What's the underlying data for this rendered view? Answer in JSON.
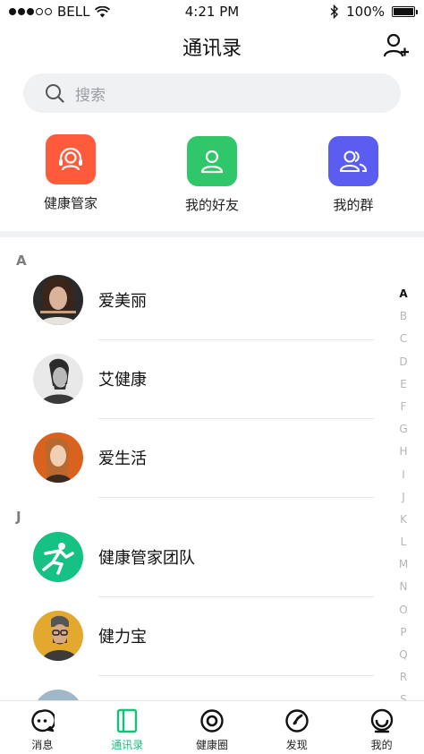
{
  "status_bar": {
    "carrier": "BELL",
    "time": "4:21 PM",
    "battery": "100%",
    "signal_filled_dots": 2,
    "signal_total_dots": 5
  },
  "header": {
    "title": "通讯录",
    "add_icon": "add-contact-icon"
  },
  "search": {
    "placeholder": "搜索"
  },
  "quick_entries": [
    {
      "label": "健康管家",
      "icon": "headset-icon",
      "color": "#ff5a3c"
    },
    {
      "label": "我的好友",
      "icon": "user-icon",
      "color": "#2fc76a"
    },
    {
      "label": "我的群",
      "icon": "group-icon",
      "color": "#5b5cf0"
    }
  ],
  "sections": [
    {
      "letter": "A",
      "contacts": [
        "爱美丽",
        "艾健康",
        "爱生活"
      ]
    },
    {
      "letter": "J",
      "contacts": [
        "健康管家团队",
        "健力宝"
      ]
    }
  ],
  "index_letters": [
    "A",
    "B",
    "C",
    "D",
    "E",
    "F",
    "G",
    "H",
    "I",
    "J",
    "K",
    "L",
    "M",
    "N",
    "O",
    "P",
    "Q",
    "R",
    "S"
  ],
  "active_index": "A",
  "tabs": [
    {
      "label": "消息",
      "icon": "message-icon"
    },
    {
      "label": "通讯录",
      "icon": "contacts-icon",
      "active": true
    },
    {
      "label": "健康圈",
      "icon": "health-circle-icon"
    },
    {
      "label": "发现",
      "icon": "compass-icon"
    },
    {
      "label": "我的",
      "icon": "profile-icon"
    }
  ],
  "colors": {
    "accent": "#16bf7a",
    "search_bg": "#f0f1f3",
    "divider_band": "#f1f2f4"
  }
}
